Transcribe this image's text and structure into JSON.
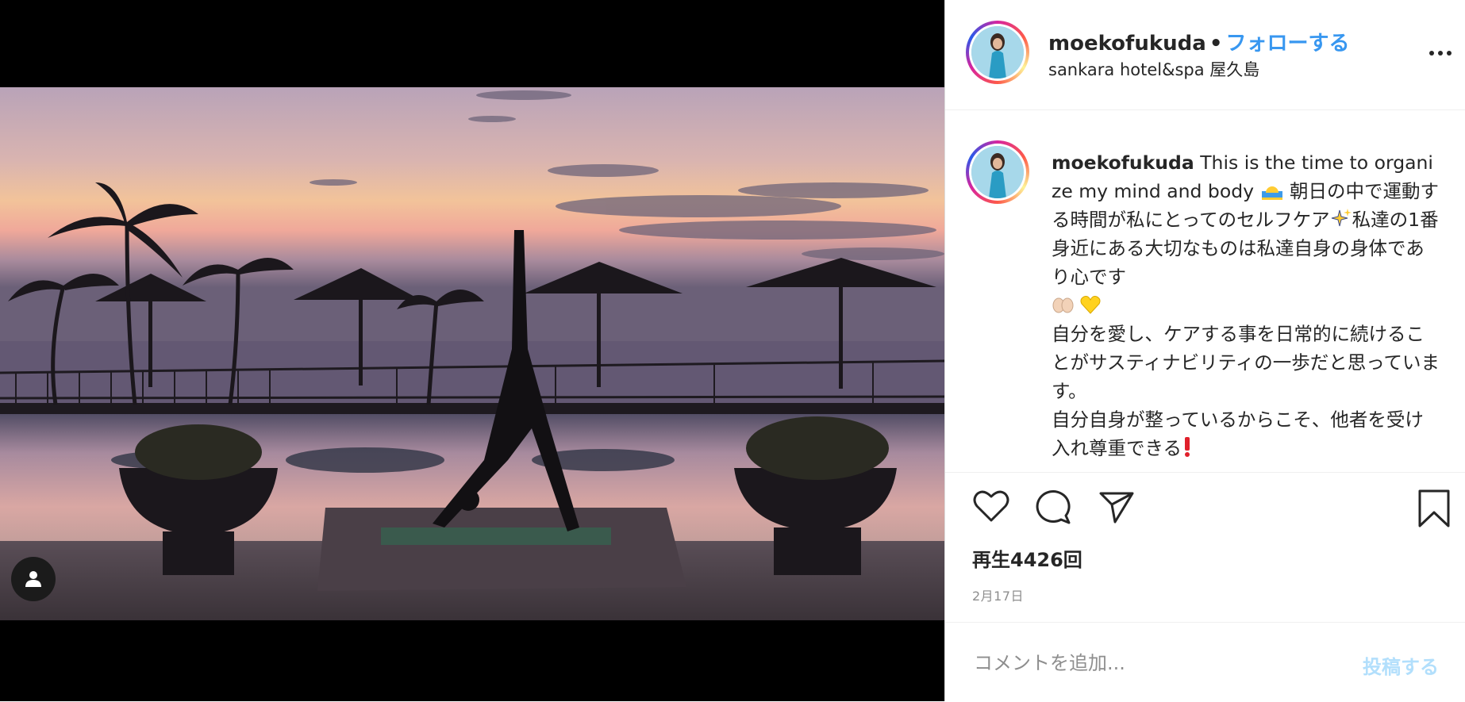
{
  "post": {
    "username": "moekofukuda",
    "separator": "•",
    "follow_label": "フォローする",
    "location": "sankara hotel&spa 屋久島"
  },
  "caption": {
    "username": "moekofukuda",
    "line1": "This is the time to organize my mind and body",
    "line1b": "朝日の中で運動する時間が私にとってのセルフケア",
    "line1c": "私達の1番身近にある大切なものは私達自身の身体であり心です",
    "para2": "自分を愛し、ケアする事を日常的に続けることがサスティナビリティの一歩だと思っています。",
    "para3": "自分自身が整っているからこそ、他者を受け入れ尊重できる"
  },
  "stats": {
    "views": "再生4426回",
    "date": "2月17日"
  },
  "comment": {
    "placeholder": "コメントを追加...",
    "post_label": "投稿する"
  },
  "icons": [
    "user-tag-icon",
    "more-options-icon",
    "like-heart-icon",
    "comment-icon",
    "share-icon",
    "bookmark-icon"
  ],
  "colors": {
    "follow": "#3897f0",
    "post_disabled": "#b2dffc",
    "muted": "#8e8e8e"
  }
}
